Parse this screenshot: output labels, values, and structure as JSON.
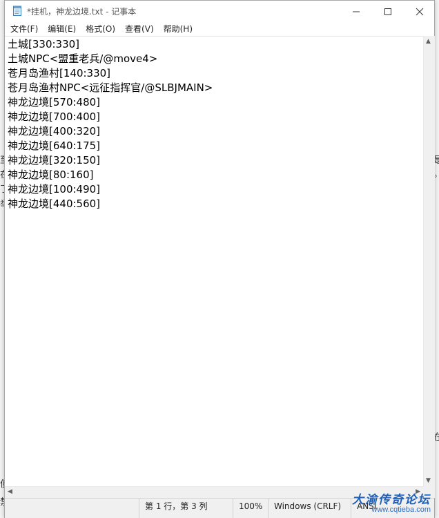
{
  "window": {
    "title": "*挂机，神龙边境.txt - 记事本"
  },
  "menu": [
    {
      "label": "文件(F)"
    },
    {
      "label": "编辑(E)"
    },
    {
      "label": "格式(O)"
    },
    {
      "label": "查看(V)"
    },
    {
      "label": "帮助(H)"
    }
  ],
  "editor": {
    "lines": [
      "土城[330:330]",
      "土城NPC<盟重老兵/@move4>",
      "苍月岛渔村[140:330]",
      "苍月岛渔村NPC<远征指挥官/@SLBJMAIN>",
      "神龙边境[570:480]",
      "神龙边境[700:400]",
      "神龙边境[400:320]",
      "神龙边境[640:175]",
      "神龙边境[320:150]",
      "神龙边境[80:160]",
      "神龙边境[100:490]",
      "神龙边境[440:560]"
    ]
  },
  "statusbar": {
    "position": "第 1 行，第 3 列",
    "zoom": "100%",
    "line_ending": "Windows (CRLF)",
    "encoding": "ANSI"
  },
  "watermark": {
    "title": "大渝传奇论坛",
    "url": "www.cqtieba.com"
  },
  "background": {
    "left_chars": [
      "至",
      "在",
      "了,",
      "举"
    ],
    "left_bottom_chars": [
      "便",
      "禁"
    ],
    "right_chars": [
      "是",
      "。",
      "在"
    ]
  }
}
